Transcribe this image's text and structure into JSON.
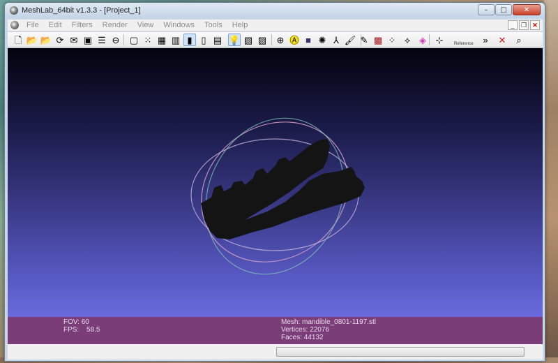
{
  "window": {
    "title": "MeshLab_64bit v1.3.3 - [Project_1]",
    "controls": [
      "minimize",
      "maximize",
      "close"
    ]
  },
  "menubar": {
    "items": [
      "File",
      "Edit",
      "Filters",
      "Render",
      "View",
      "Windows",
      "Tools",
      "Help"
    ]
  },
  "toolbar": {
    "icons": [
      {
        "name": "new-project-icon",
        "glyph": "🗋",
        "active": false
      },
      {
        "name": "open-project-icon",
        "glyph": "📂",
        "active": false
      },
      {
        "name": "import-mesh-icon",
        "glyph": "📂",
        "active": false
      },
      {
        "name": "reload-icon",
        "glyph": "⟳",
        "active": false
      },
      {
        "name": "save-snapshot-icon",
        "glyph": "✉",
        "active": false
      },
      {
        "name": "snapshot-icon",
        "glyph": "▣",
        "active": false
      },
      {
        "name": "layer-icon",
        "glyph": "☰",
        "active": false
      },
      {
        "name": "export-icon",
        "glyph": "⊖",
        "active": false
      },
      {
        "name": "bounding-box-icon",
        "glyph": "▢",
        "active": false
      },
      {
        "name": "points-icon",
        "glyph": "⁙",
        "active": false
      },
      {
        "name": "wireframe-icon",
        "glyph": "▦",
        "active": false
      },
      {
        "name": "hidden-lines-icon",
        "glyph": "▥",
        "active": false
      },
      {
        "name": "flat-shading-icon",
        "glyph": "▮",
        "active": true
      },
      {
        "name": "smooth-shading-icon",
        "glyph": "▯",
        "active": false
      },
      {
        "name": "texture-icon",
        "glyph": "▤",
        "active": false
      },
      {
        "name": "light-icon",
        "glyph": "💡",
        "active": true
      },
      {
        "name": "color-icon",
        "glyph": "▧",
        "active": false
      },
      {
        "name": "back-face-icon",
        "glyph": "▨",
        "active": false
      },
      {
        "name": "center-icon",
        "glyph": "⊕",
        "active": false
      },
      {
        "name": "annotation-icon",
        "glyph": "Ⓐ",
        "active": false
      },
      {
        "name": "quality-icon",
        "glyph": "■",
        "active": false
      },
      {
        "name": "render-icon",
        "glyph": "✺",
        "active": false
      },
      {
        "name": "axis-icon",
        "glyph": "⅄",
        "active": false
      },
      {
        "name": "brush-icon",
        "glyph": "🖌",
        "active": false
      },
      {
        "name": "paint-icon",
        "glyph": "✎",
        "active": false
      },
      {
        "name": "select-faces-icon",
        "glyph": "▩",
        "active": false
      },
      {
        "name": "select-vertices-icon",
        "glyph": "⁘",
        "active": false
      },
      {
        "name": "align-icon",
        "glyph": "⟡",
        "active": false
      },
      {
        "name": "color-map-icon",
        "glyph": "◈",
        "active": false
      },
      {
        "name": "reference-icon",
        "glyph": "⊹",
        "active": false
      },
      {
        "name": "more-tools-icon",
        "glyph": "»",
        "active": false
      },
      {
        "name": "delete-icon",
        "glyph": "✕",
        "active": false
      },
      {
        "name": "search-icon",
        "glyph": "⌕",
        "active": false
      }
    ],
    "reference_label": "Reference"
  },
  "viewport": {
    "fov_label": "FOV:",
    "fov_value": "60",
    "fps_label": "FPS:",
    "fps_value": "58.5",
    "mesh_line": "Mesh: mandible_0801-1197.stl",
    "vertices_line": "Vertices: 22076",
    "faces_line": "Faces: 44132"
  },
  "colors": {
    "background_top": "#03030e",
    "background_bottom": "#6a6ade",
    "info_bar": "#7b3d78",
    "mesh": "#141414",
    "trackball_pink": "#d7a1c8",
    "trackball_teal": "#7fc1b8"
  }
}
